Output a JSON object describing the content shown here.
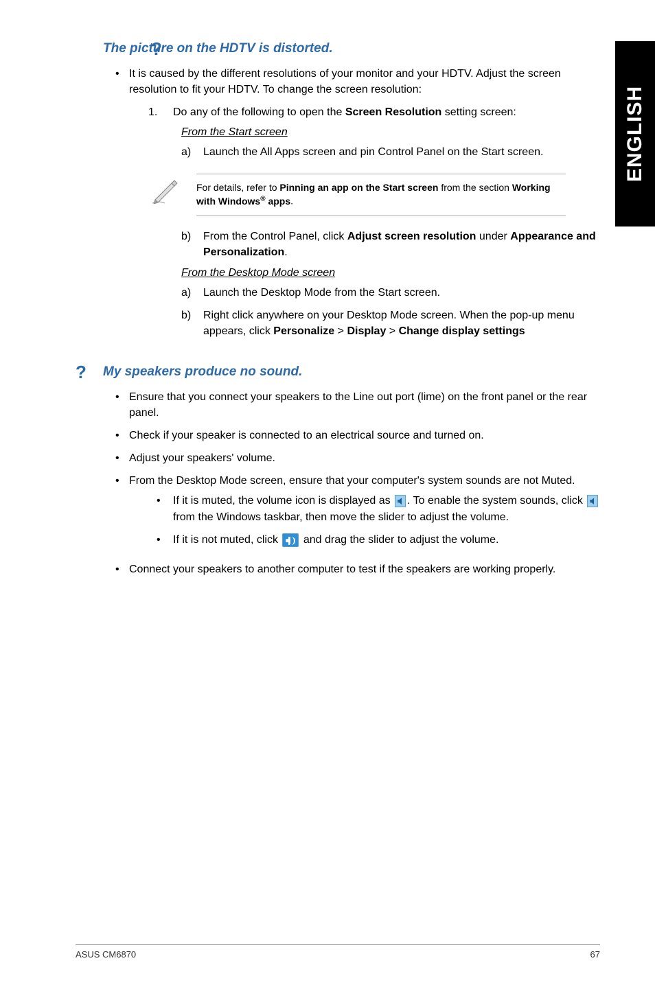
{
  "side_label": "ENGLISH",
  "q1": {
    "heading": "The picture on the HDTV is distorted.",
    "bullet1": "It is caused by the different resolutions of your monitor and your HDTV. Adjust the screen resolution to fit your HDTV. To change the screen resolution:",
    "step1_pre": "Do any of the following to open the ",
    "step1_bold": "Screen Resolution",
    "step1_post": " setting screen:",
    "from_start": "From the Start screen",
    "step_a": "Launch the All Apps screen and pin Control Panel on the Start screen.",
    "note_pre": "For details, refer to ",
    "note_b1": "Pinning an app on the Start screen",
    "note_mid": " from the section ",
    "note_b2_pre": "Working with Windows",
    "note_b2_sup": "®",
    "note_b2_post": " apps",
    "step_b_pre": "From the Control Panel, click ",
    "step_b_bold1": "Adjust screen resolution",
    "step_b_mid": " under ",
    "step_b_bold2": "Appearance and Personalization",
    "from_desktop": "From the Desktop Mode screen",
    "d_a": "Launch the Desktop Mode from the Start screen.",
    "d_b_pre": "Right click anywhere on your Desktop Mode screen. When the pop-up menu appears, click ",
    "d_b_b1": "Personalize",
    "d_b_b2": "Display",
    "d_b_b3": "Change display settings"
  },
  "q2": {
    "heading": "My speakers produce no sound.",
    "b1": "Ensure that you connect your speakers to the Line out port (lime) on the front panel or the rear panel.",
    "b2": "Check if your speaker is connected to an electrical source and turned on.",
    "b3": "Adjust your speakers' volume.",
    "b4": "From the Desktop Mode screen, ensure that your computer's system sounds are not Muted.",
    "b4a_pre": "If it is muted, the volume icon is displayed as ",
    "b4a_mid": ". To enable the system sounds, click ",
    "b4a_post": " from the Windows taskbar, then move the slider to adjust the volume.",
    "b4b_pre": "If it is not muted, click ",
    "b4b_post": " and drag the slider to adjust the volume.",
    "b5": "Connect your speakers to another computer to test if the speakers are working properly."
  },
  "footer": {
    "left": "ASUS CM6870",
    "right": "67"
  },
  "labels": {
    "one": "1.",
    "a": "a)",
    "b": "b)",
    "gt": " > "
  }
}
